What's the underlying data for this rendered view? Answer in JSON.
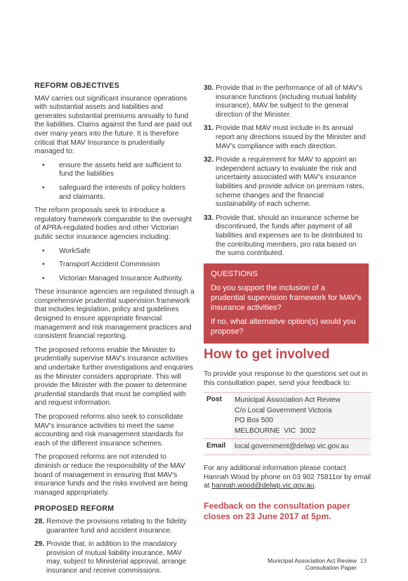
{
  "left": {
    "reform_objectives": {
      "heading": "REFORM OBJECTIVES",
      "para1": "MAV carries out significant insurance operations with substantial assets and liabilities and generates substantial premiums annually to fund the liabilities. Claims against the fund are paid out over many years into the future. It is therefore critical that MAV Insurance is prudentially managed to:",
      "bullets1": [
        "ensure the assets held are sufficient to fund the liabilities",
        "safeguard the interests of policy holders and claimants."
      ],
      "para2": "The reform proposals seek to introduce a regulatory framework comparable to the oversight of APRA-regulated bodies and other Victorian public sector insurance agencies including:",
      "bullets2": [
        "WorkSafe",
        "Transport Accident Commission",
        "Victorian Managed Insurance Authority."
      ],
      "para3": "These insurance agencies are regulated through a comprehensive prudential supervision framework that includes legislation, policy and guidelines designed to ensure appropriate financial management and risk management practices and consistent financial reporting.",
      "para4": "The proposed reforms enable the Minister to prudentially supervise MAV's insurance activities and undertake further investigations and enquiries as the Minister considers appropriate. This will provide the Minister with the power to determine prudential standards that must be complied with and request information.",
      "para5": "The proposed reforms also seek to consolidate MAV's insurance activities to meet the same accounting and risk management standards for each of the different insurance schemes.",
      "para6": "The proposed reforms are not intended to diminish or reduce the responsibility of the MAV board of management in ensuring that MAV's insurance funds and the risks involved are being managed appropriately."
    },
    "proposed_reform": {
      "heading": "PROPOSED REFORM",
      "items": [
        {
          "num": "28.",
          "text": "Remove the provisions relating to the fidelity guarantee fund and accident insurance."
        },
        {
          "num": "29.",
          "text": "Provide that, in addition to the mandatory provision of mutual liability insurance, MAV may, subject to Ministerial approval, arrange insurance and receive commissions."
        }
      ]
    }
  },
  "right": {
    "items": [
      {
        "num": "30.",
        "text": "Provide that in the performance of all of MAV's insurance functions (including mutual liability insurance), MAV be subject to the general direction of the Minister."
      },
      {
        "num": "31.",
        "text": "Provide that MAV must include in its annual report any directions issued by the Minister and MAV's compliance with each direction."
      },
      {
        "num": "32.",
        "text": "Provide a requirement for MAV to appoint an independent actuary to evaluate the risk and uncertainty associated with MAV's insurance liabilities and provide advice on premium rates, scheme changes and the financial sustainability of each scheme."
      },
      {
        "num": "33.",
        "text": "Provide that, should an insurance scheme be discontinued, the funds after payment of all liabilities and expenses are to be distributed to the contributing members, pro rata based on the sums contributed."
      }
    ],
    "questions": {
      "title": "QUESTIONS",
      "q1": "Do you support the inclusion of a prudential supervision framework for MAV's insurance activities?",
      "q2": "If no, what alternative option(s) would you propose?"
    },
    "how": {
      "heading": "How to get involved",
      "intro": "To provide your response to the questions set out in this consultation paper, send your feedback to:",
      "post_label": "Post",
      "post_lines": [
        "Municipal Association Act Review",
        "C/o Local Government Victoria",
        "PO Box 500",
        "MELBOURNE  VIC  3002"
      ],
      "email_label": "Email",
      "email_value": "local.government@delwp.vic.gov.au",
      "more_prefix": "For any additional information please contact Hannah Wood by phone on 03 902 75811or by email at ",
      "more_link": "hannah.wood@delwp.vic.gov.au",
      "more_suffix": ".",
      "closing": "Feedback on the consultation paper closes on 23 June 2017 at 5pm."
    }
  },
  "footer": {
    "line1": "Municipal Association Act Review",
    "line2": "Consultation Paper",
    "page": "13"
  },
  "colors": {
    "accent": "#c0494d"
  }
}
